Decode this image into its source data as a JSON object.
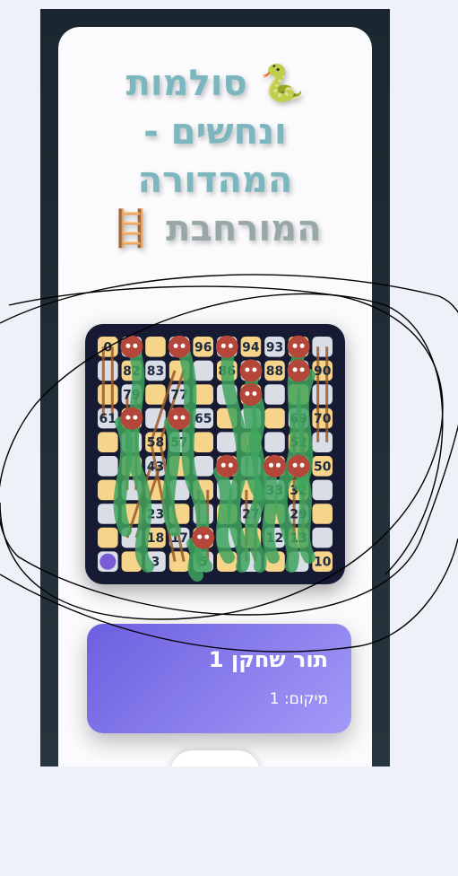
{
  "page": {
    "title_line_1": "🐍 סולמות",
    "title_line_2": "ונחשים -",
    "title_line_3": "המהדורה",
    "title_line_4_text": "המורחבת",
    "title_line_4_icon": "🪜"
  },
  "board": {
    "columns": 10,
    "rows": 10,
    "visible_numbers": [
      {
        "n": "0",
        "row": 0,
        "col": 0
      },
      {
        "n": "96",
        "row": 0,
        "col": 4
      },
      {
        "n": "94",
        "row": 0,
        "col": 6
      },
      {
        "n": "93",
        "row": 0,
        "col": 7
      },
      {
        "n": "82",
        "row": 1,
        "col": 1
      },
      {
        "n": "83",
        "row": 1,
        "col": 2
      },
      {
        "n": "86",
        "row": 1,
        "col": 5
      },
      {
        "n": "88",
        "row": 1,
        "col": 7
      },
      {
        "n": "90",
        "row": 1,
        "col": 9
      },
      {
        "n": "79",
        "row": 2,
        "col": 1
      },
      {
        "n": "77",
        "row": 2,
        "col": 3
      },
      {
        "n": "61",
        "row": 3,
        "col": 0
      },
      {
        "n": "65",
        "row": 3,
        "col": 4
      },
      {
        "n": "69",
        "row": 3,
        "col": 8
      },
      {
        "n": "70",
        "row": 3,
        "col": 9
      },
      {
        "n": "58",
        "row": 4,
        "col": 2
      },
      {
        "n": "57",
        "row": 4,
        "col": 3
      },
      {
        "n": "52",
        "row": 4,
        "col": 8
      },
      {
        "n": "43",
        "row": 5,
        "col": 2
      },
      {
        "n": "50",
        "row": 5,
        "col": 9
      },
      {
        "n": "33",
        "row": 6,
        "col": 7
      },
      {
        "n": "32",
        "row": 6,
        "col": 8
      },
      {
        "n": "23",
        "row": 7,
        "col": 2
      },
      {
        "n": "27",
        "row": 7,
        "col": 6
      },
      {
        "n": "29",
        "row": 7,
        "col": 8
      },
      {
        "n": "18",
        "row": 8,
        "col": 2
      },
      {
        "n": "17",
        "row": 8,
        "col": 3
      },
      {
        "n": "12",
        "row": 8,
        "col": 7
      },
      {
        "n": "13",
        "row": 8,
        "col": 8
      },
      {
        "n": "3",
        "row": 9,
        "col": 2
      },
      {
        "n": "5",
        "row": 9,
        "col": 4
      },
      {
        "n": "10",
        "row": 9,
        "col": 9
      }
    ],
    "snake_heads": [
      {
        "row": 0,
        "col": 1
      },
      {
        "row": 0,
        "col": 3
      },
      {
        "row": 0,
        "col": 5
      },
      {
        "row": 0,
        "col": 8
      },
      {
        "row": 1,
        "col": 6
      },
      {
        "row": 1,
        "col": 8
      },
      {
        "row": 2,
        "col": 6
      },
      {
        "row": 3,
        "col": 1
      },
      {
        "row": 3,
        "col": 3
      },
      {
        "row": 5,
        "col": 5
      },
      {
        "row": 5,
        "col": 7
      },
      {
        "row": 5,
        "col": 8
      },
      {
        "row": 8,
        "col": 4
      }
    ],
    "ladder_icon": "ladder-icon",
    "snake_color": "#3fa35e",
    "snake_head_color": "#b4473a",
    "ladder_color": "#9a5a2a",
    "even_cell_color": "#f6d58a",
    "odd_cell_color": "#d8dde6"
  },
  "turn": {
    "title": "תור שחקן 1",
    "position_label": "מיקום: 1"
  },
  "roll_button": {
    "label": ""
  }
}
